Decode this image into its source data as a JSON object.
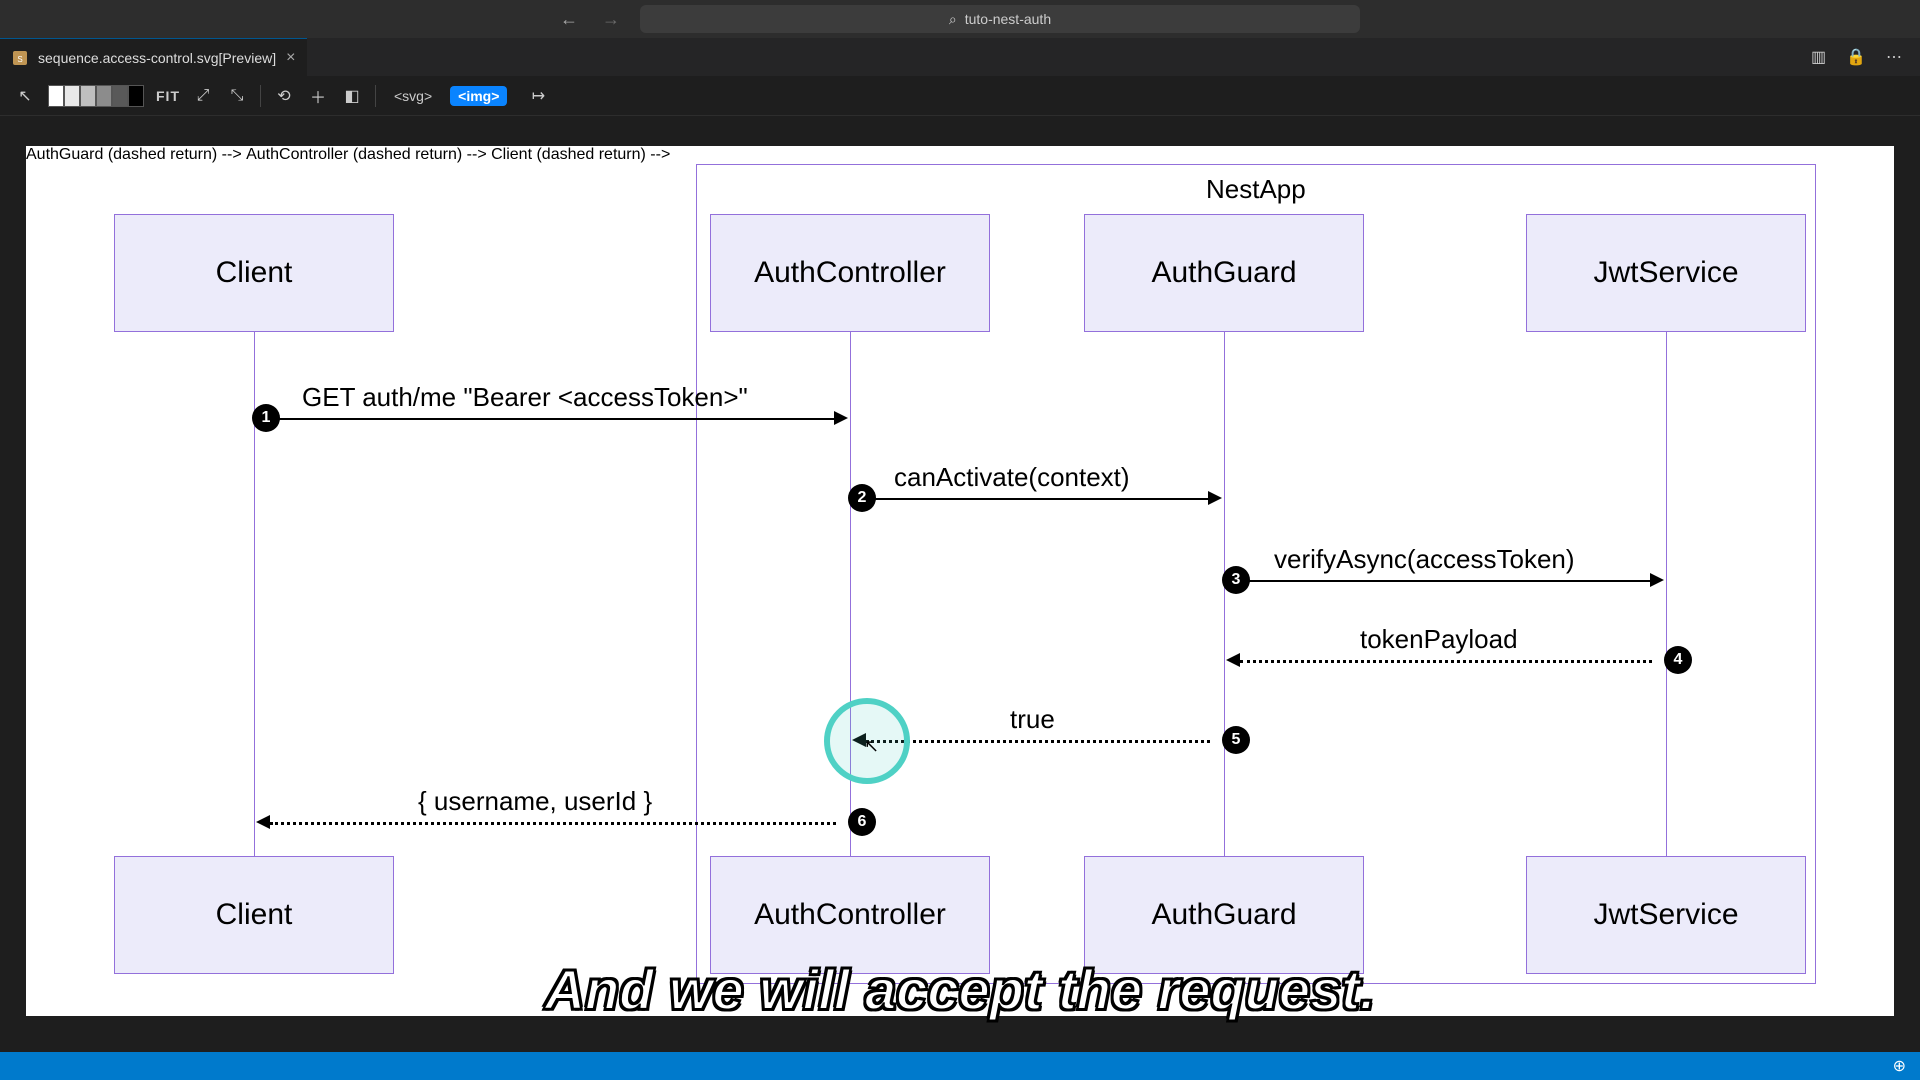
{
  "window": {
    "project": "tuto-nest-auth"
  },
  "tab": {
    "title": "sequence.access-control.svg[Preview]"
  },
  "toolbar": {
    "fit": "FIT",
    "svg_tag": "<svg>",
    "img_tag": "<img>",
    "swatches": [
      "#ffffff",
      "#e8e8e8",
      "#bfbfbf",
      "#8c8c8c",
      "#595959",
      "#000000"
    ]
  },
  "diagram": {
    "container_label": "NestApp",
    "participants": {
      "client": "Client",
      "auth_controller": "AuthController",
      "auth_guard": "AuthGuard",
      "jwt_service": "JwtService"
    },
    "messages": {
      "m1": "GET auth/me \"Bearer <accessToken>\"",
      "m2": "canActivate(context)",
      "m3": "verifyAsync(accessToken)",
      "m4": "tokenPayload",
      "m5": "true",
      "m6": "{ username, userId }"
    },
    "steps": {
      "s1": "1",
      "s2": "2",
      "s3": "3",
      "s4": "4",
      "s5": "5",
      "s6": "6"
    }
  },
  "subtitle": "And we will accept the request.",
  "colors": {
    "participant_bg": "#ecebfa",
    "participant_border": "#9370DB",
    "highlight": "#4fd1c5",
    "tag_active": "#0a84ff",
    "statusbar": "#007acc"
  }
}
